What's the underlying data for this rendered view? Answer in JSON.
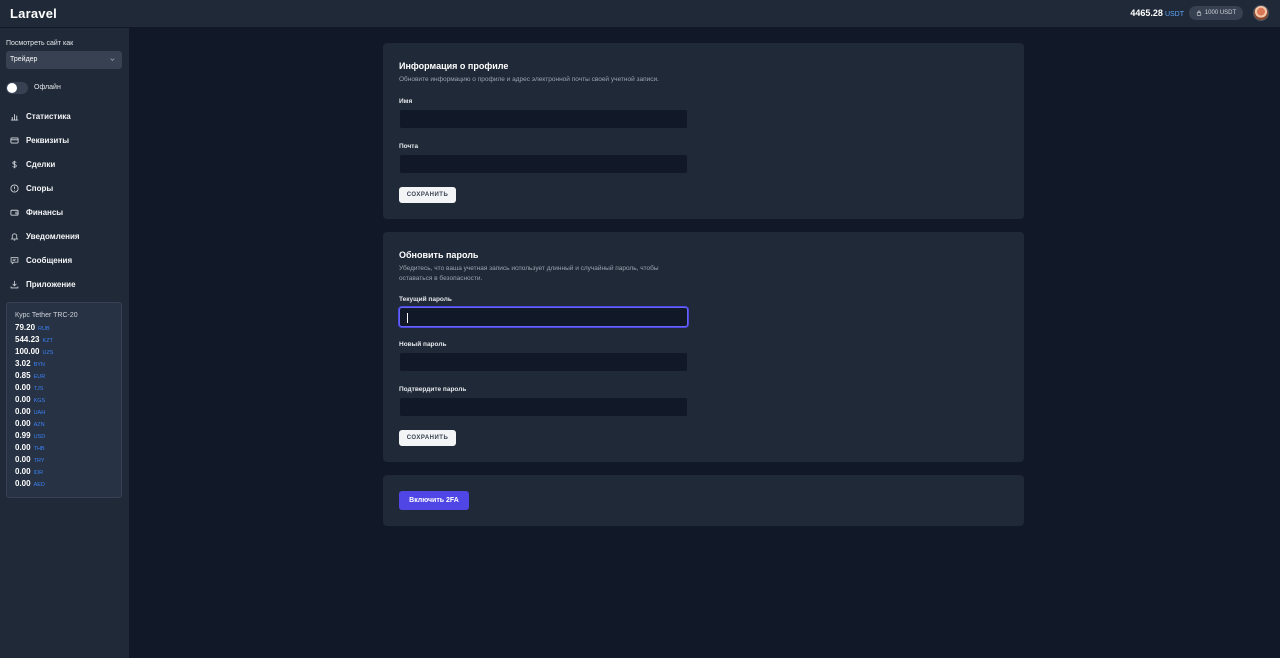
{
  "header": {
    "brand": "Laravel",
    "balance_value": "4465.28",
    "balance_currency": "USDT",
    "locked_label": "1000 USDT"
  },
  "sidebar": {
    "view_as_label": "Посмотреть сайт как",
    "view_as_selected": "Трейдер",
    "status_label": "Офлайн",
    "items": [
      {
        "label": "Статистика",
        "icon": "chart-icon"
      },
      {
        "label": "Реквизиты",
        "icon": "card-icon"
      },
      {
        "label": "Сделки",
        "icon": "dollar-icon"
      },
      {
        "label": "Споры",
        "icon": "alert-icon"
      },
      {
        "label": "Финансы",
        "icon": "wallet-icon"
      },
      {
        "label": "Уведомления",
        "icon": "bell-icon"
      },
      {
        "label": "Сообщения",
        "icon": "message-icon"
      },
      {
        "label": "Приложение",
        "icon": "download-icon"
      }
    ],
    "rates": {
      "title": "Курс Tether TRC-20",
      "rows": [
        {
          "value": "79.20",
          "currency": "RUB"
        },
        {
          "value": "544.23",
          "currency": "KZT"
        },
        {
          "value": "100.00",
          "currency": "UZS"
        },
        {
          "value": "3.02",
          "currency": "BYN"
        },
        {
          "value": "0.85",
          "currency": "EUR"
        },
        {
          "value": "0.00",
          "currency": "TJS"
        },
        {
          "value": "0.00",
          "currency": "KGS"
        },
        {
          "value": "0.00",
          "currency": "UAH"
        },
        {
          "value": "0.00",
          "currency": "AZN"
        },
        {
          "value": "0.99",
          "currency": "USD"
        },
        {
          "value": "0.00",
          "currency": "THB"
        },
        {
          "value": "0.00",
          "currency": "TRY"
        },
        {
          "value": "0.00",
          "currency": "IDR"
        },
        {
          "value": "0.00",
          "currency": "AED"
        }
      ]
    }
  },
  "profile": {
    "title": "Информация о профиле",
    "subtitle": "Обновите информацию о профиле и адрес электронной почты своей учетной записи.",
    "name_label": "Имя",
    "name_value": "",
    "email_label": "Почта",
    "email_value": "",
    "save_label": "СОХРАНИТЬ"
  },
  "password": {
    "title": "Обновить пароль",
    "subtitle": "Убедитесь, что ваша учетная запись использует длинный и случайный пароль, чтобы оставаться в безопасности.",
    "current_label": "Текущий пароль",
    "new_label": "Новый пароль",
    "confirm_label": "Подтвердите пароль",
    "save_label": "СОХРАНИТЬ"
  },
  "twofa": {
    "button_label": "Включить 2FA"
  },
  "colors": {
    "background": "#111827",
    "panel": "#1f2937",
    "accent": "#4f46e5",
    "currency": "#3b82f6"
  }
}
